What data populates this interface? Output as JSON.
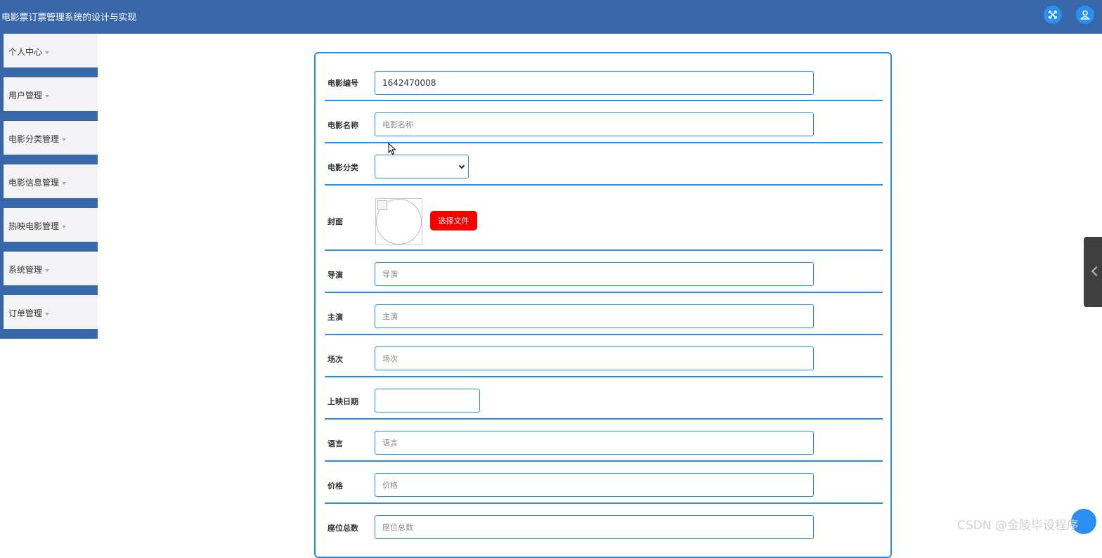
{
  "app": {
    "title": "电影票订票管理系统的设计与实现"
  },
  "header": {
    "expand_icon": "expand-icon",
    "user_icon": "user-icon"
  },
  "sidebar": {
    "items": [
      {
        "label": "个人中心"
      },
      {
        "label": "用户管理"
      },
      {
        "label": "电影分类管理"
      },
      {
        "label": "电影信息管理"
      },
      {
        "label": "热映电影管理"
      },
      {
        "label": "系统管理"
      },
      {
        "label": "订单管理"
      }
    ]
  },
  "form": {
    "movie_id": {
      "label": "电影编号",
      "value": "1642470008"
    },
    "movie_name": {
      "label": "电影名称",
      "placeholder": "电影名称"
    },
    "category": {
      "label": "电影分类",
      "value": ""
    },
    "cover": {
      "label": "封面",
      "button_label": "选择文件"
    },
    "director": {
      "label": "导演",
      "placeholder": "导演"
    },
    "cast": {
      "label": "主演",
      "placeholder": "主演"
    },
    "session": {
      "label": "场次",
      "placeholder": "场次"
    },
    "release_date": {
      "label": "上映日期",
      "value": ""
    },
    "language": {
      "label": "语言",
      "placeholder": "语言"
    },
    "price": {
      "label": "价格",
      "placeholder": "价格"
    },
    "seats": {
      "label": "座位总数",
      "placeholder": "座位总数"
    }
  },
  "watermark": "CSDN @金陵毕设程序",
  "colors": {
    "header": "#3767a9",
    "accent": "#2d8be0",
    "file_button": "#f70000",
    "icon_button": "#2a8ff0"
  }
}
